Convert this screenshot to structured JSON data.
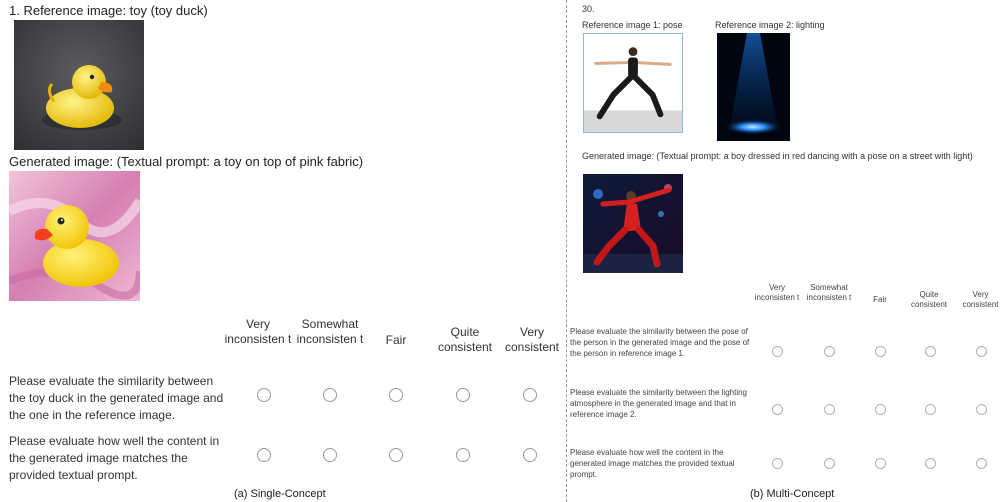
{
  "left": {
    "title": "1. Reference image: toy (toy duck)",
    "generated_label": "Generated image: (Textual prompt: a toy on top of pink fabric)",
    "columns": [
      "Very inconsisten t",
      "Somewhat inconsisten t",
      "Fair",
      "Quite consistent",
      "Very consistent"
    ],
    "questions": [
      "Please evaluate the similarity between the toy duck in the generated image and the one in the reference image.",
      "Please evaluate how well the content in the generated image matches the provided textual prompt."
    ],
    "caption": "(a) Single-Concept"
  },
  "right": {
    "number": "30.",
    "ref1_label": "Reference image 1: pose",
    "ref2_label": "Reference image 2: lighting",
    "generated_label": "Generated image: (Textual prompt: a boy dressed in red dancing with a pose on a street with light)",
    "columns": [
      "Very inconsisten t",
      "Somewhat inconsisten t",
      "Fair",
      "Quite consistent",
      "Very consistent"
    ],
    "questions": [
      "Please evaluate the similarity between the pose of the person in the generated image and the pose of the person in reference image 1.",
      "Please evaluate the similarity between the lighting atmosphere in the generated image and that in reference image 2.",
      "Please evaluate how well the content in the generated image matches the provided textual prompt."
    ],
    "caption": "(b) Multi-Concept"
  }
}
